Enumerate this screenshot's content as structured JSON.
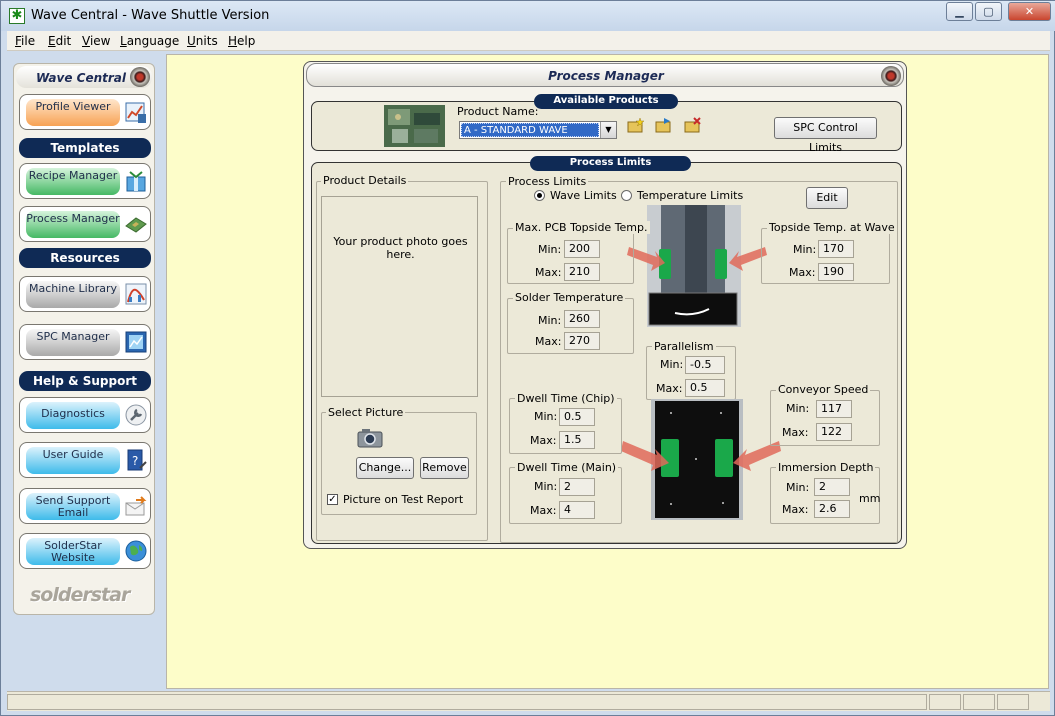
{
  "window": {
    "title": "Wave Central - Wave Shuttle Version",
    "minimize": "▁",
    "maximize": "▢",
    "close": "✕"
  },
  "menu": [
    {
      "label": "File",
      "key": "F",
      "rest": "ile"
    },
    {
      "label": "Edit",
      "key": "E",
      "rest": "dit"
    },
    {
      "label": "View",
      "key": "V",
      "rest": "iew"
    },
    {
      "label": "Language",
      "key": "L",
      "rest": "anguage"
    },
    {
      "label": "Units",
      "key": "U",
      "rest": "nits"
    },
    {
      "label": "Help",
      "key": "H",
      "rest": "elp"
    }
  ],
  "sidebar": {
    "title": "Wave Central",
    "profile_viewer": "Profile Viewer",
    "templates": "Templates",
    "recipe_manager": "Recipe Manager",
    "process_manager": "Process Manager",
    "resources": "Resources",
    "machine_library": "Machine Library",
    "spc_manager": "SPC Manager",
    "help_support": "Help & Support",
    "diagnostics": "Diagnostics",
    "user_guide": "User Guide",
    "send_support": "Send Support Email",
    "website": "SolderStar Website",
    "logo": "solderstar"
  },
  "process_manager": {
    "title": "Process Manager",
    "available_products": "Available Products",
    "product_name_label": "Product Name:",
    "product_name_value": "A - STANDARD WAVE",
    "spc_control_limits": "SPC Control Limits",
    "process_limits_header": "Process Limits",
    "product_details": "Product Details",
    "photo_placeholder": "Your product photo goes here.",
    "select_picture": "Select Picture",
    "change_button": "Change...",
    "remove_button": "Remove",
    "picture_on_report": "Picture on Test Report",
    "picture_on_report_checked": true,
    "process_limits_group": "Process Limits",
    "wave_limits": "Wave Limits",
    "temperature_limits": "Temperature Limits",
    "selected_mode": "wave",
    "edit_button": "Edit",
    "min_label": "Min:",
    "max_label": "Max:",
    "mm_unit": "mm",
    "max_pcb_topside": {
      "title": "Max. PCB Topside Temp.",
      "min": "200",
      "max": "210"
    },
    "topside_at_wave": {
      "title": "Topside Temp. at Wave",
      "min": "170",
      "max": "190"
    },
    "solder_temp": {
      "title": "Solder Temperature",
      "min": "260",
      "max": "270"
    },
    "parallelism": {
      "title": "Parallelism",
      "min": "-0.5",
      "max": "0.5"
    },
    "dwell_chip": {
      "title": "Dwell Time (Chip)",
      "min": "0.5",
      "max": "1.5"
    },
    "dwell_main": {
      "title": "Dwell Time (Main)",
      "min": "2",
      "max": "4"
    },
    "conveyor_speed": {
      "title": "Conveyor Speed",
      "min": "117",
      "max": "122"
    },
    "immersion_depth": {
      "title": "Immersion Depth",
      "min": "2",
      "max": "2.6"
    }
  },
  "colors": {
    "sidebar_section": "#0f2a55",
    "main_bg": "#fdfdc9",
    "panel_bg": "#ece9d8",
    "arrow": "#e06a5a",
    "sensor": "#1aa84a"
  }
}
